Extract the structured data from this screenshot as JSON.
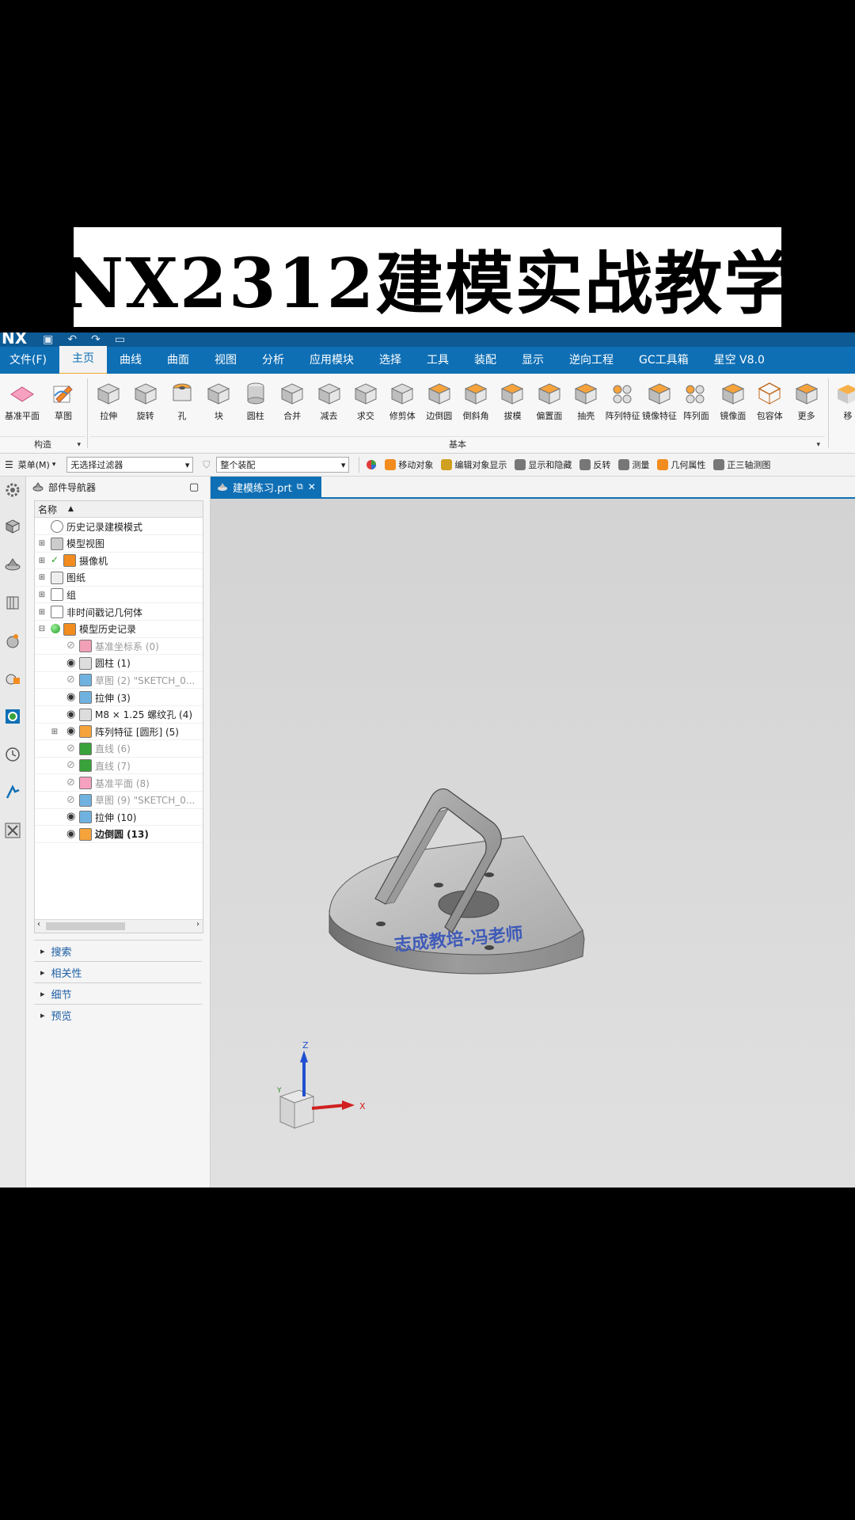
{
  "banner": {
    "text": "NX2312建模实战教学"
  },
  "titlebar": {
    "logo": "NX"
  },
  "menu": [
    {
      "label": "文件(F)",
      "active": false
    },
    {
      "label": "主页",
      "active": true
    },
    {
      "label": "曲线",
      "active": false
    },
    {
      "label": "曲面",
      "active": false
    },
    {
      "label": "视图",
      "active": false
    },
    {
      "label": "分析",
      "active": false
    },
    {
      "label": "应用模块",
      "active": false
    },
    {
      "label": "选择",
      "active": false
    },
    {
      "label": "工具",
      "active": false
    },
    {
      "label": "装配",
      "active": false
    },
    {
      "label": "显示",
      "active": false
    },
    {
      "label": "逆向工程",
      "active": false
    },
    {
      "label": "GC工具箱",
      "active": false
    },
    {
      "label": "星空 V8.0",
      "active": false
    }
  ],
  "ribbon": {
    "group1": {
      "label": "构造",
      "buttons": [
        "基准平面",
        "草图"
      ]
    },
    "group2": {
      "label": "基本",
      "buttons": [
        "拉伸",
        "旋转",
        "孔",
        "块",
        "圆柱",
        "合并",
        "减去",
        "求交",
        "修剪体",
        "边倒圆",
        "倒斜角",
        "拔模",
        "偏置面",
        "抽壳",
        "阵列特征",
        "镜像特征",
        "阵列面",
        "镜像面",
        "包容体",
        "更多"
      ]
    },
    "trailing": "移"
  },
  "toolbar": {
    "menu_label": "菜单(M)",
    "filter_value": "无选择过滤器",
    "scope_value": "整个装配",
    "items": [
      "移动对象",
      "编辑对象显示",
      "显示和隐藏",
      "反转",
      "测量",
      "几何属性",
      "正三轴测图"
    ]
  },
  "navigator": {
    "title": "部件导航器",
    "column": "名称",
    "rows": [
      {
        "text": "历史记录建模模式",
        "level": 0,
        "expand": "",
        "icon": "clock-icon",
        "style": ""
      },
      {
        "text": "模型视图",
        "level": 0,
        "expand": "+",
        "icon": "model-view-icon",
        "style": ""
      },
      {
        "text": "摄像机",
        "level": 0,
        "expand": "+",
        "icon": "camera-icon",
        "style": "",
        "check": true
      },
      {
        "text": "图纸",
        "level": 0,
        "expand": "+",
        "icon": "drawing-icon",
        "style": ""
      },
      {
        "text": "组",
        "level": 0,
        "expand": "+",
        "icon": "group-icon",
        "style": ""
      },
      {
        "text": "非时间戳记几何体",
        "level": 0,
        "expand": "+",
        "icon": "folder-icon",
        "style": ""
      },
      {
        "text": "模型历史记录",
        "level": 0,
        "expand": "-",
        "icon": "history-icon",
        "style": "",
        "green": true
      },
      {
        "text": "基准坐标系 (0)",
        "level": 1,
        "icon": "datum-csys-icon",
        "style": "dim",
        "hidden": true
      },
      {
        "text": "圆柱 (1)",
        "level": 1,
        "icon": "cylinder-icon",
        "style": ""
      },
      {
        "text": "草图 (2) \"SKETCH_0...",
        "level": 1,
        "icon": "sketch-icon",
        "style": "dim",
        "hidden": true
      },
      {
        "text": "拉伸 (3)",
        "level": 1,
        "icon": "extrude-icon",
        "style": ""
      },
      {
        "text": "M8 × 1.25 螺纹孔 (4)",
        "level": 1,
        "icon": "threaded-hole-icon",
        "style": ""
      },
      {
        "text": "阵列特征 [圆形] (5)",
        "level": 1,
        "icon": "pattern-feature-icon",
        "style": "",
        "expand": "+"
      },
      {
        "text": "直线 (6)",
        "level": 1,
        "icon": "line-icon",
        "style": "dim",
        "hidden": true
      },
      {
        "text": "直线 (7)",
        "level": 1,
        "icon": "line-icon",
        "style": "dim",
        "hidden": true
      },
      {
        "text": "基准平面 (8)",
        "level": 1,
        "icon": "datum-plane-icon",
        "style": "dim",
        "hidden": true
      },
      {
        "text": "草图 (9) \"SKETCH_0...",
        "level": 1,
        "icon": "sketch-icon",
        "style": "dim",
        "hidden": true
      },
      {
        "text": "拉伸 (10)",
        "level": 1,
        "icon": "extrude-icon",
        "style": ""
      },
      {
        "text": "边倒圆 (13)",
        "level": 1,
        "icon": "edge-blend-icon",
        "style": "bold"
      }
    ],
    "panes": [
      "搜索",
      "相关性",
      "细节",
      "预览"
    ]
  },
  "document_tab": {
    "label": "建模练习.prt"
  },
  "model": {
    "engraving": "志成教培-冯老师"
  },
  "triad": {
    "x": "X",
    "y": "Y",
    "z": "Z"
  },
  "colors": {
    "accent": "#0e6fb5",
    "title": "#0d5a94",
    "feature": "#f28c1e"
  }
}
